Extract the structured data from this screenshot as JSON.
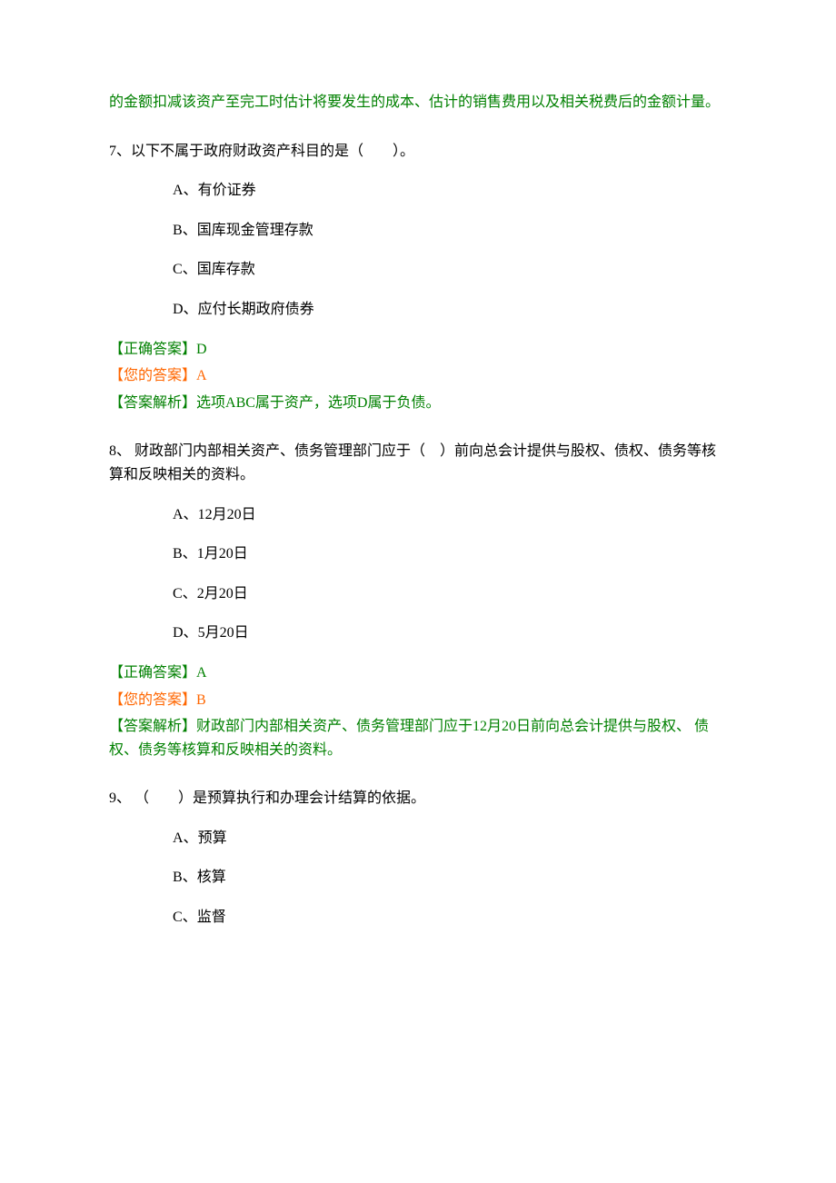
{
  "intro_fragment": "的金额扣减该资产至完工时估计将要发生的成本、估计的销售费用以及相关税费后的金额计量。",
  "labels": {
    "correct": "【正确答案】",
    "your": "【您的答案】",
    "explain": "【答案解析】"
  },
  "questions": [
    {
      "number": "7、",
      "stem": "以下不属于政府财政资产科目的是（　　）。",
      "options": [
        {
          "label": "A、",
          "text": "有价证券"
        },
        {
          "label": "B、",
          "text": "国库现金管理存款"
        },
        {
          "label": "C、",
          "text": "国库存款"
        },
        {
          "label": "D、",
          "text": "应付长期政府债券"
        }
      ],
      "correct": "D",
      "your": "A",
      "explanation": "选项ABC属于资产，选项D属于负债。"
    },
    {
      "number": "8、",
      "stem": " 财政部门内部相关资产、债务管理部门应于（　）前向总会计提供与股权、债权、债务等核算和反映相关的资料。",
      "options": [
        {
          "label": "A、",
          "text": "12月20日"
        },
        {
          "label": "B、",
          "text": "1月20日"
        },
        {
          "label": "C、",
          "text": "2月20日"
        },
        {
          "label": "D、",
          "text": "5月20日"
        }
      ],
      "correct": "A",
      "your": "B",
      "explanation": "财政部门内部相关资产、债务管理部门应于12月20日前向总会计提供与股权、 债权、债务等核算和反映相关的资料。"
    },
    {
      "number": "9、",
      "stem": " （　　）是预算执行和办理会计结算的依据。",
      "options": [
        {
          "label": "A、",
          "text": "预算"
        },
        {
          "label": "B、",
          "text": "核算"
        },
        {
          "label": "C、",
          "text": "监督"
        }
      ],
      "correct": null,
      "your": null,
      "explanation": null
    }
  ]
}
